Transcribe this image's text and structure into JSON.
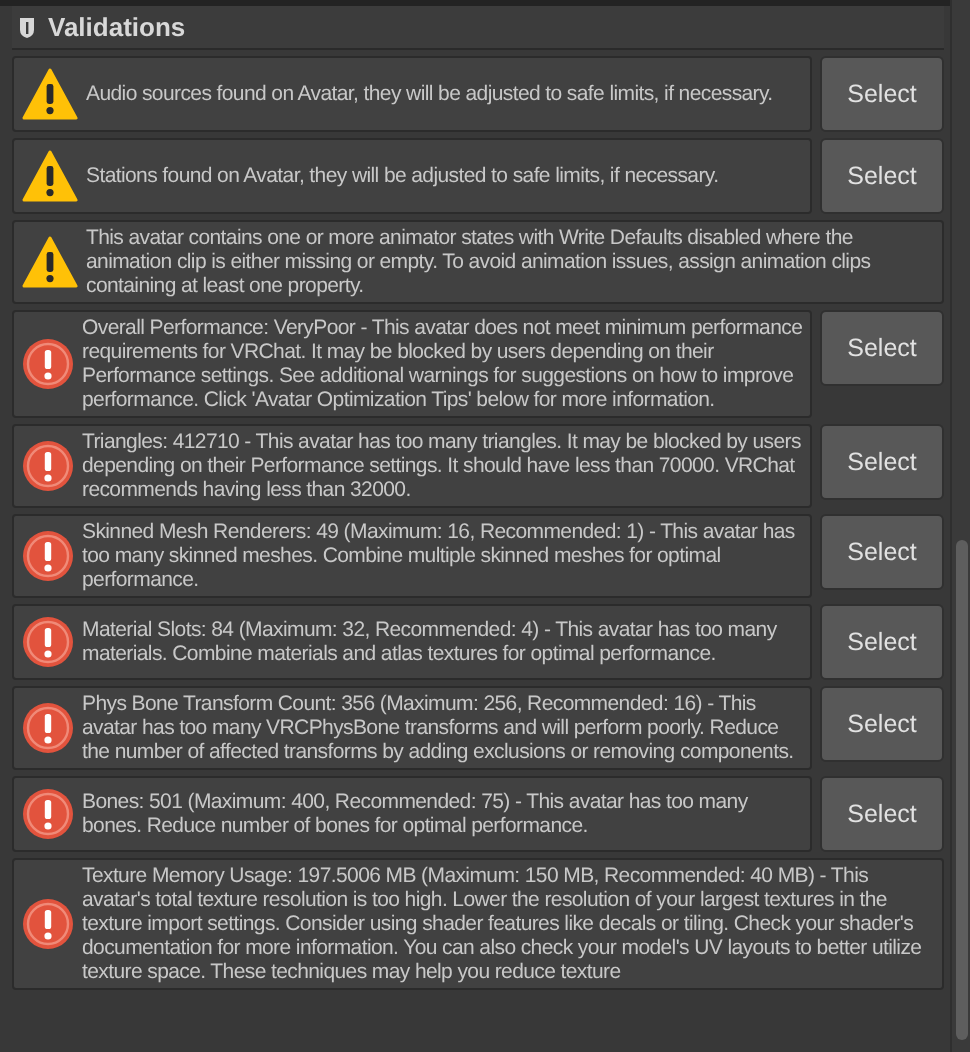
{
  "header": {
    "title": "Validations"
  },
  "items": [
    {
      "kind": "warning",
      "text": "Audio sources found on Avatar, they will be adjusted to safe limits, if necessary.",
      "button": "Select"
    },
    {
      "kind": "warning",
      "text": "Stations found on Avatar, they will be adjusted to safe limits, if necessary.",
      "button": "Select"
    },
    {
      "kind": "warning",
      "text": "This avatar contains one or more animator states with Write Defaults disabled where the animation clip is either missing or empty. To avoid animation issues, assign animation clips containing at least one property."
    },
    {
      "kind": "error",
      "text": "Overall Performance: VeryPoor - This avatar does not meet minimum performance requirements for VRChat. It may be blocked by users depending on their Performance settings. See additional warnings for suggestions on how to improve performance. Click 'Avatar Optimization Tips' below for more information.",
      "button": "Select"
    },
    {
      "kind": "error",
      "text": "Triangles: 412710 - This avatar has too many triangles. It may be blocked by users depending on their Performance settings. It should have less than 70000. VRChat recommends having less than 32000.",
      "button": "Select"
    },
    {
      "kind": "error",
      "text": "Skinned Mesh Renderers: 49 (Maximum: 16, Recommended: 1) - This avatar has too many skinned meshes. Combine multiple skinned meshes for optimal performance.",
      "button": "Select"
    },
    {
      "kind": "error",
      "text": "Material Slots: 84 (Maximum: 32, Recommended: 4) - This avatar has too many materials. Combine materials and atlas textures for optimal performance.",
      "button": "Select"
    },
    {
      "kind": "error",
      "text": "Phys Bone Transform Count: 356 (Maximum: 256, Recommended: 16) - This avatar has too many VRCPhysBone transforms and will perform poorly. Reduce the number of affected transforms by adding exclusions or removing components.",
      "button": "Select"
    },
    {
      "kind": "error",
      "text": "Bones: 501 (Maximum: 400, Recommended: 75) - This avatar has too many bones. Reduce number of bones for optimal performance.",
      "button": "Select"
    },
    {
      "kind": "error",
      "text": "Texture Memory Usage: 197.5006 MB (Maximum: 150 MB, Recommended: 40 MB) - This avatar's total texture resolution is too high. Lower the resolution of your largest textures in the texture import settings. Consider using shader features like decals or tiling. Check your shader's documentation for more information. You can also check your model's UV layouts to better utilize texture space. These techniques may help you reduce texture"
    }
  ]
}
